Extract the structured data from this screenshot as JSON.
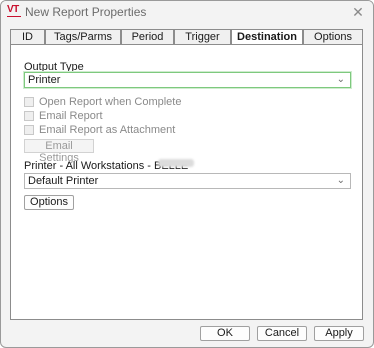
{
  "window": {
    "title": "New Report Properties",
    "logo_text": "VT",
    "close_glyph": "✕"
  },
  "tabs": [
    {
      "label": "ID"
    },
    {
      "label": "Tags/Parms"
    },
    {
      "label": "Period"
    },
    {
      "label": "Trigger"
    },
    {
      "label": "Destination",
      "active": true
    },
    {
      "label": "Options"
    }
  ],
  "destination": {
    "output_type_label": "Output Type",
    "output_type_value": "Printer",
    "open_when_complete": "Open Report when Complete",
    "email_report": "Email Report",
    "email_attachment": "Email Report as Attachment",
    "email_settings": "Email Settings",
    "printer_label": "Printer - All Workstations - BELLE",
    "printer_value": "Default Printer",
    "options_button": "Options"
  },
  "footer": {
    "ok": "OK",
    "cancel": "Cancel",
    "apply": "Apply"
  },
  "colors": {
    "logo_red": "#c8102e",
    "focus_green": "#7ec97e"
  }
}
